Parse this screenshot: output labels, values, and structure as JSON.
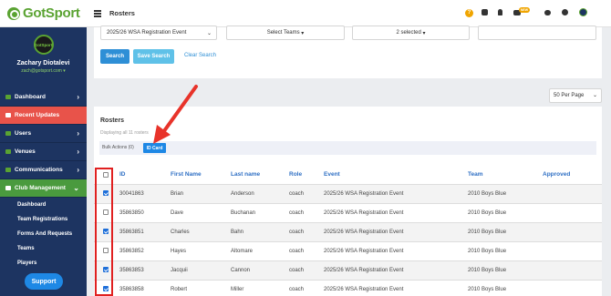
{
  "brand": {
    "name": "GotSport",
    "avatar_text": "GotSport"
  },
  "user": {
    "name": "Zachary Diotalevi",
    "email": "zach@gotsport.com"
  },
  "sidebar": {
    "items": [
      {
        "label": "Dashboard",
        "state": "normal"
      },
      {
        "label": "Recent Updates",
        "state": "highlight"
      },
      {
        "label": "Users",
        "state": "normal"
      },
      {
        "label": "Venues",
        "state": "normal"
      },
      {
        "label": "Communications",
        "state": "normal"
      },
      {
        "label": "Club Management",
        "state": "open"
      }
    ],
    "subitems": [
      "Dashboard",
      "Team Registrations",
      "Forms And Requests",
      "Teams",
      "Players"
    ],
    "support_label": "Support"
  },
  "topbar": {
    "title": "Rosters",
    "badge": "NEW"
  },
  "filters": {
    "event": "2025/26 WSA Registration Event",
    "teams": "Select Teams",
    "selected": "2 selected",
    "search_label": "Search",
    "save_search_label": "Save Search",
    "clear_label": "Clear Search"
  },
  "per_page": "50 Per Page",
  "rosters": {
    "title": "Rosters",
    "subtitle": "Displaying all 11 rosters",
    "bulk_label": "Bulk Actions (0)",
    "idcard_label": "ID Card",
    "columns": [
      "ID",
      "First Name",
      "Last name",
      "Role",
      "Event",
      "Team",
      "Approved"
    ],
    "rows": [
      {
        "checked": true,
        "id": "30041863",
        "first": "Brian",
        "last": "Anderson",
        "role": "coach",
        "event": "2025/26 WSA Registration Event",
        "team": "2010 Boys Blue"
      },
      {
        "checked": false,
        "id": "35863850",
        "first": "Dave",
        "last": "Buchanan",
        "role": "coach",
        "event": "2025/26 WSA Registration Event",
        "team": "2010 Boys Blue"
      },
      {
        "checked": true,
        "id": "35863851",
        "first": "Charles",
        "last": "Bahn",
        "role": "coach",
        "event": "2025/26 WSA Registration Event",
        "team": "2010 Boys Blue"
      },
      {
        "checked": false,
        "id": "35863852",
        "first": "Hayes",
        "last": "Altomare",
        "role": "coach",
        "event": "2025/26 WSA Registration Event",
        "team": "2010 Boys Blue"
      },
      {
        "checked": true,
        "id": "35863853",
        "first": "Jacquii",
        "last": "Cannon",
        "role": "coach",
        "event": "2025/26 WSA Registration Event",
        "team": "2010 Boys Blue"
      },
      {
        "checked": true,
        "id": "35863858",
        "first": "Robert",
        "last": "Miller",
        "role": "coach",
        "event": "2025/26 WSA Registration Event",
        "team": "2010 Boys Blue"
      }
    ]
  }
}
